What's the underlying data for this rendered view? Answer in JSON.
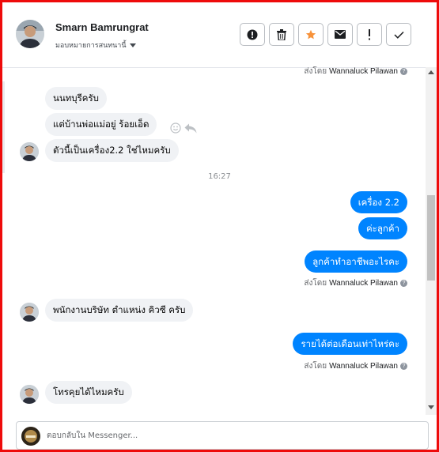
{
  "header": {
    "contact_name": "Smarn Bamrungrat",
    "assign_label": "มอบหมายการสนทนานี้"
  },
  "toolbar": {
    "buttons": [
      {
        "name": "alert",
        "icon": "alert-circle-icon"
      },
      {
        "name": "delete",
        "icon": "trash-icon"
      },
      {
        "name": "star",
        "icon": "star-icon"
      },
      {
        "name": "email",
        "icon": "envelope-icon"
      },
      {
        "name": "spam",
        "icon": "exclamation-icon"
      },
      {
        "name": "done",
        "icon": "check-icon"
      }
    ]
  },
  "conversation": {
    "sent_by_prefix": "ส่งโดย",
    "agent_name": "Wannaluck Pilawan",
    "timestamp": "16:27",
    "messages": [
      {
        "side": "in",
        "text": "นนทบุรีครับ"
      },
      {
        "side": "in",
        "text": "แต่บ้านพ่อแม่อยู่ ร้อยเอ็ด"
      },
      {
        "side": "in",
        "text": "ตัวนี้เป็นเครื่อง2.2 ใช่ไหมครับ"
      },
      {
        "side": "out",
        "text": "เครื่อง 2.2"
      },
      {
        "side": "out",
        "text": "ค่ะลูกค้า"
      },
      {
        "side": "out",
        "text": "ลูกค้าทำอาชีพอะไรคะ"
      },
      {
        "side": "in",
        "text": "พนักงานบริษัท ตำแหน่ง คิวซี ครับ"
      },
      {
        "side": "out",
        "text": "รายได้ต่อเดือนเท่าไหร่คะ"
      },
      {
        "side": "in",
        "text": "โทรคุยได้ไหมครับ"
      }
    ]
  },
  "composer": {
    "placeholder": "ตอบกลับใน Messenger..."
  },
  "colors": {
    "frame_border": "#ee0b0b",
    "outgoing_bubble": "#0084ff",
    "incoming_bubble": "#f0f2f5",
    "star": "#f7923a"
  }
}
